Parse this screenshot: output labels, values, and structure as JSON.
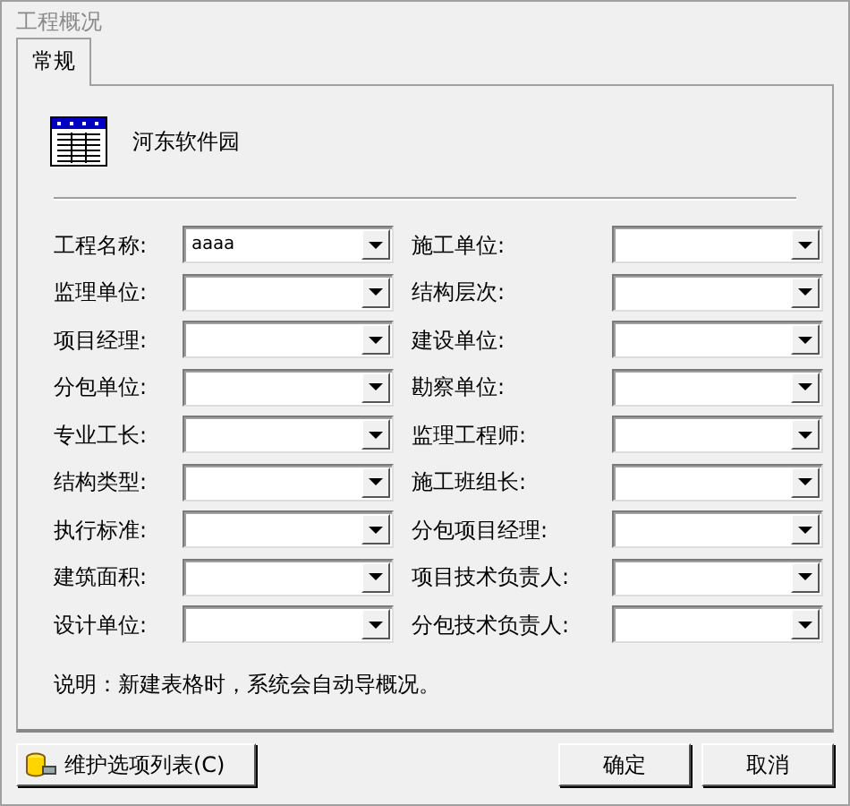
{
  "window": {
    "title": "工程概况"
  },
  "tabs": [
    {
      "label": "常规",
      "selected": true
    }
  ],
  "header": {
    "text": "河东软件园"
  },
  "fields": [
    {
      "label": "工程名称:",
      "value": "aaaa"
    },
    {
      "label": "施工单位:"
    },
    {
      "label": "监理单位:"
    },
    {
      "label": "结构层次:"
    },
    {
      "label": "项目经理:"
    },
    {
      "label": "建设单位:"
    },
    {
      "label": "分包单位:"
    },
    {
      "label": "勘察单位:"
    },
    {
      "label": "专业工长:"
    },
    {
      "label": "监理工程师:"
    },
    {
      "label": "结构类型:"
    },
    {
      "label": "施工班组长:"
    },
    {
      "label": "执行标准:"
    },
    {
      "label": "分包项目经理:"
    },
    {
      "label": "建筑面积:"
    },
    {
      "label": "项目技术负责人:"
    },
    {
      "label": "设计单位:"
    },
    {
      "label": "分包技术负责人:"
    }
  ],
  "note": "说明：新建表格时，系统会自动导概况。",
  "buttons": [
    {
      "label": "维护选项列表(C)",
      "kind": "icon"
    },
    {
      "label": "确定",
      "kind": "plain"
    },
    {
      "label": "取消",
      "kind": "plain"
    }
  ]
}
